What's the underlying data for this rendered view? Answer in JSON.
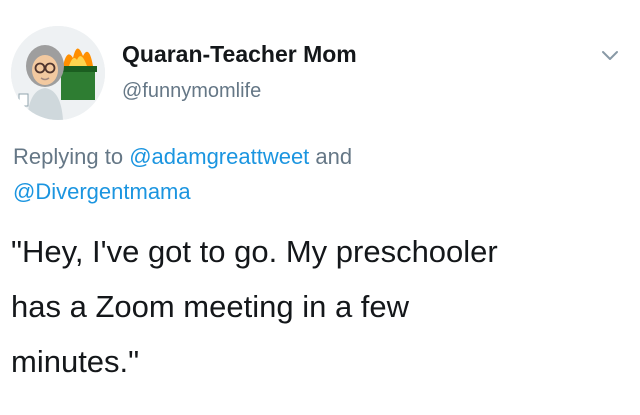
{
  "author": {
    "display_name": "Quaran-Teacher Mom",
    "handle": "@funnymomlife"
  },
  "reply": {
    "prefix": "Replying to",
    "mention_1": "@adamgreattweet",
    "conjunction": "and",
    "mention_2": "@Divergentmama"
  },
  "tweet_text": {
    "line1": "\"Hey, I've got to go. My preschooler",
    "line2": "has a Zoom meeting in a few",
    "line3": "minutes.\""
  },
  "icons": {
    "menu": "chevron-down-icon",
    "avatar": "cartoon-teacher-with-burning-dumpster"
  },
  "colors": {
    "link": "#1b95e0",
    "secondary_text": "#657786",
    "primary_text": "#14171a"
  }
}
